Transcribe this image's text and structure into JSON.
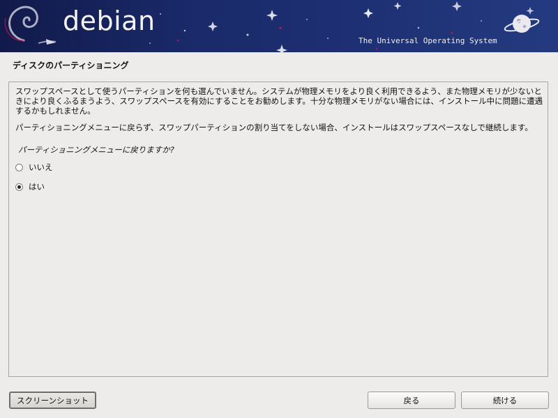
{
  "banner": {
    "brand": "debian",
    "tagline": "The Universal Operating System"
  },
  "page": {
    "title": "ディスクのパーティショニング"
  },
  "content": {
    "paragraph1": "スワップスペースとして使うパーティションを何も選んでいません。システムが物理メモリをより良く利用できるよう、また物理メモリが少ないときにより良くふるまうよう、スワップスペースを有効にすることをお勧めします。十分な物理メモリがない場合には、インストール中に問題に遭遇するかもしれません。",
    "paragraph2": "パーティショニングメニューに戻らず、スワップパーティションの割り当てをしない場合、インストールはスワップスペースなしで継続します。",
    "question": "パーティショニングメニューに戻りますか?",
    "options": [
      {
        "label": "いいえ",
        "selected": false
      },
      {
        "label": "はい",
        "selected": true
      }
    ]
  },
  "buttons": {
    "screenshot": "スクリーンショット",
    "back": "戻る",
    "continue": "続ける"
  },
  "colors": {
    "banner_dark": "#111a4a",
    "banner_light": "#243a80",
    "background": "#edeceb",
    "swirl_accent": "#d0105a"
  },
  "icons": {
    "banner_logo": "debian-swirl-icon",
    "planet": "planet-icon"
  }
}
